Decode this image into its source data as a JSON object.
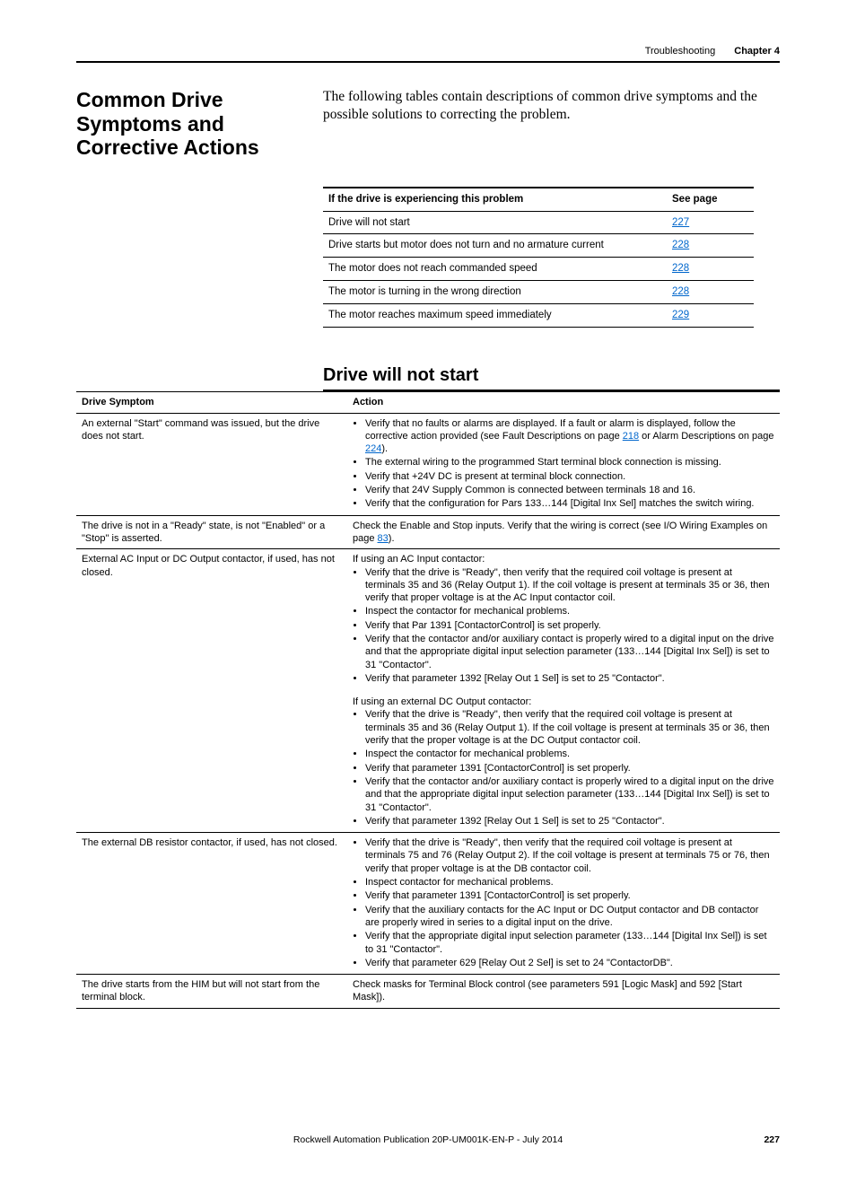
{
  "header": {
    "section": "Troubleshooting",
    "chapter": "Chapter 4"
  },
  "sectionTitle": "Common Drive Symptoms and Corrective Actions",
  "introText": "The following tables contain descriptions of common drive symptoms and the possible solutions to correcting the problem.",
  "navTable": {
    "headers": [
      "If the drive is experiencing this problem",
      "See page"
    ],
    "rows": [
      {
        "problem": "Drive will not start",
        "page": "227"
      },
      {
        "problem": "Drive starts but motor does not turn and no armature current",
        "page": "228"
      },
      {
        "problem": "The motor does not reach commanded speed",
        "page": "228"
      },
      {
        "problem": "The motor is turning in the wrong direction",
        "page": "228"
      },
      {
        "problem": "The motor reaches maximum speed immediately",
        "page": "229"
      }
    ]
  },
  "subTitle": "Drive will not start",
  "detailTable": {
    "headers": [
      "Drive Symptom",
      "Action"
    ],
    "row1": {
      "symptom": "An external \"Start\" command was issued, but the drive does not start.",
      "actions": {
        "b1a": "Verify that no faults or alarms are displayed. If a fault or alarm is displayed, follow the corrective action provided (see Fault Descriptions on page ",
        "b1link1": "218",
        "b1mid": " or Alarm Descriptions on page ",
        "b1link2": "224",
        "b1end": ").",
        "b2": "The external wiring to the programmed Start terminal block connection is missing.",
        "b3": "Verify that +24V DC is present at terminal block connection.",
        "b4": "Verify that 24V Supply Common is connected between terminals 18 and 16.",
        "b5": "Verify that the configuration for Pars 133…144 [Digital Inx Sel] matches the switch wiring."
      }
    },
    "row2": {
      "symptom": "The drive is not in a \"Ready\" state, is not \"Enabled\" or a \"Stop\" is asserted.",
      "actionPrefix": "Check the Enable and Stop inputs. Verify that the wiring is correct (see I/O Wiring Examples on page ",
      "actionLink": "83",
      "actionSuffix": ")."
    },
    "row3": {
      "symptom": "External AC Input or DC Output contactor, if used, has not closed.",
      "block1Title": "If using an AC Input contactor:",
      "block1": {
        "b1": "Verify that the drive is \"Ready\", then verify that the required coil voltage is present at terminals 35 and 36 (Relay Output 1). If the coil voltage is present at terminals 35 or 36, then verify that proper voltage is at the AC Input contactor coil.",
        "b2": "Inspect the contactor for mechanical problems.",
        "b3": "Verify that Par 1391 [ContactorControl] is set properly.",
        "b4": "Verify that the contactor and/or auxiliary contact is properly wired to a digital input on the drive and that the appropriate digital input selection parameter (133…144 [Digital Inx Sel]) is set to 31 \"Contactor\".",
        "b5": "Verify that parameter 1392 [Relay Out 1 Sel] is set to 25 \"Contactor\"."
      },
      "block2Title": "If using an external DC Output contactor:",
      "block2": {
        "b1": "Verify that the drive is \"Ready\", then verify that the required coil voltage is present at terminals 35 and 36 (Relay Output 1). If the coil voltage is present at terminals 35 or 36, then verify that the proper voltage is at the DC Output contactor coil.",
        "b2": "Inspect the contactor for mechanical problems.",
        "b3": "Verify that parameter 1391 [ContactorControl] is set properly.",
        "b4": "Verify that the contactor and/or auxiliary contact is properly wired to a digital input on the drive and that the appropriate digital input selection parameter (133…144 [Digital Inx Sel]) is set to 31 \"Contactor\".",
        "b5": "Verify that parameter 1392 [Relay Out 1 Sel] is set to 25 \"Contactor\"."
      }
    },
    "row4": {
      "symptom": "The external DB resistor contactor, if used, has not closed.",
      "actions": {
        "b1": "Verify that the drive is \"Ready\", then verify that the required coil voltage is present at terminals 75 and 76 (Relay Output 2). If the coil voltage is present at terminals 75 or 76, then verify that proper voltage is at the DB contactor coil.",
        "b2": "Inspect contactor for mechanical problems.",
        "b3": "Verify that parameter 1391 [ContactorControl] is set properly.",
        "b4": "Verify that the auxiliary contacts for the AC Input or DC Output contactor and DB contactor are properly wired in series to a digital input on the drive.",
        "b5": "Verify that the appropriate digital input selection parameter (133…144 [Digital Inx Sel]) is set to 31 \"Contactor\".",
        "b6": "Verify that parameter 629 [Relay Out 2 Sel] is set to 24 \"ContactorDB\"."
      }
    },
    "row5": {
      "symptom": "The drive starts from the HIM but will not start from the terminal block.",
      "action": "Check masks for Terminal Block control (see parameters 591 [Logic Mask] and 592 [Start Mask])."
    }
  },
  "footer": {
    "text": "Rockwell Automation Publication 20P-UM001K-EN-P - July 2014",
    "page": "227"
  }
}
